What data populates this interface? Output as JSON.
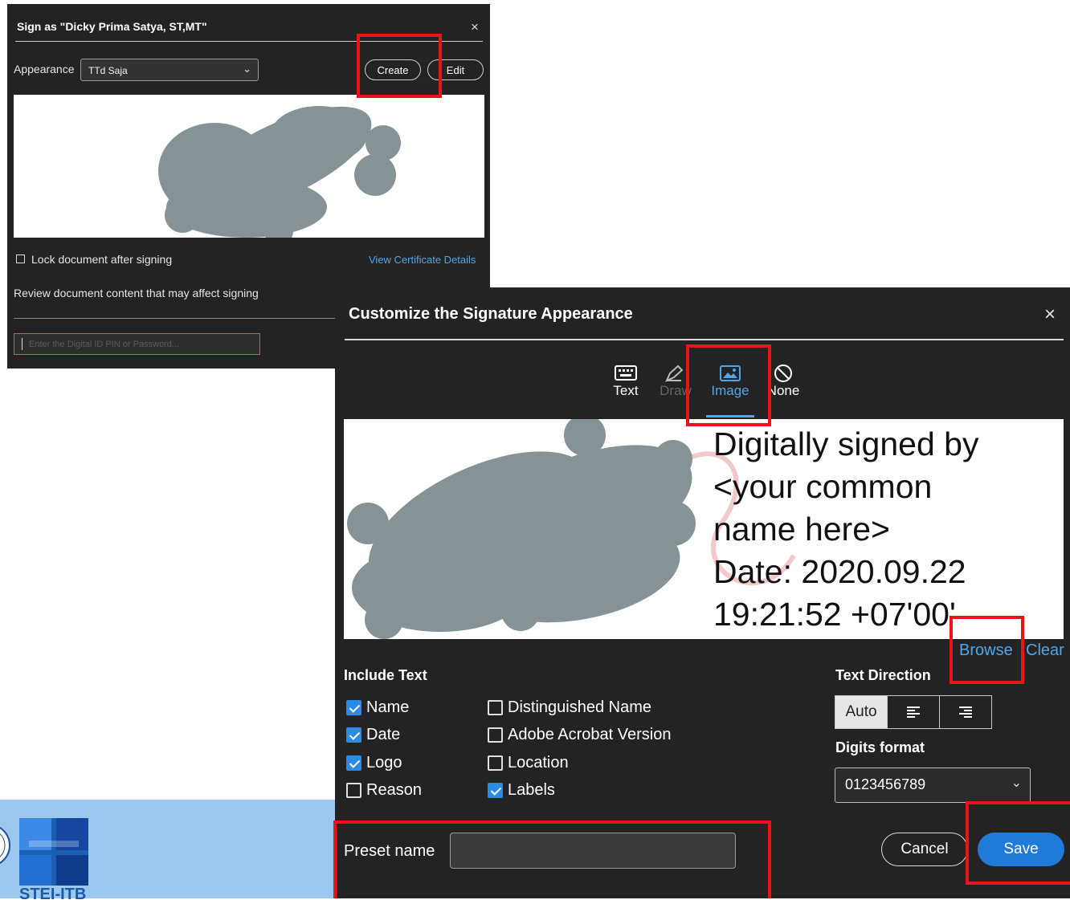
{
  "sign_dialog": {
    "title": "Sign as \"Dicky Prima Satya, ST,MT\"",
    "close_glyph": "×",
    "appearance_label": "Appearance",
    "appearance_value": "TTd Saja",
    "create_label": "Create",
    "edit_label": "Edit",
    "lock_label": "Lock document after signing",
    "view_cert_label": "View Certificate Details",
    "review_label": "Review document content that may affect signing",
    "pin_placeholder": "Enter the Digital ID PIN or Password..."
  },
  "customize_dialog": {
    "title": "Customize the Signature Appearance",
    "close_glyph": "×",
    "tabs": [
      {
        "label": "Text",
        "icon": "keyboard-icon"
      },
      {
        "label": "Draw",
        "icon": "pen-icon"
      },
      {
        "label": "Image",
        "icon": "image-icon"
      },
      {
        "label": "None",
        "icon": "none-icon"
      }
    ],
    "preview_lines": [
      "Digitally signed by",
      "<your common",
      "name here>",
      "Date: 2020.09.22",
      "19:21:52 +07'00'"
    ],
    "browse_label": "Browse",
    "clear_label": "Clear",
    "include_text_label": "Include Text",
    "checkboxes": [
      {
        "label": "Name",
        "checked": true
      },
      {
        "label": "Date",
        "checked": true
      },
      {
        "label": "Logo",
        "checked": true
      },
      {
        "label": "Reason",
        "checked": false
      },
      {
        "label": "Distinguished Name",
        "checked": false
      },
      {
        "label": "Adobe Acrobat Version",
        "checked": false
      },
      {
        "label": "Location",
        "checked": false
      },
      {
        "label": "Labels",
        "checked": true
      }
    ],
    "text_direction_label": "Text Direction",
    "text_direction_auto": "Auto",
    "digits_format_label": "Digits format",
    "digits_format_value": "0123456789",
    "preset_name_label": "Preset name",
    "cancel_label": "Cancel",
    "save_label": "Save"
  },
  "background": {
    "logo_text": "STEI-ITB"
  },
  "colors": {
    "accent_blue": "#2b8ce6",
    "link_blue": "#4ea7ea",
    "highlight_red": "#e8141c",
    "dialog_bg": "#232323",
    "page_strip": "#9cc8f0"
  }
}
